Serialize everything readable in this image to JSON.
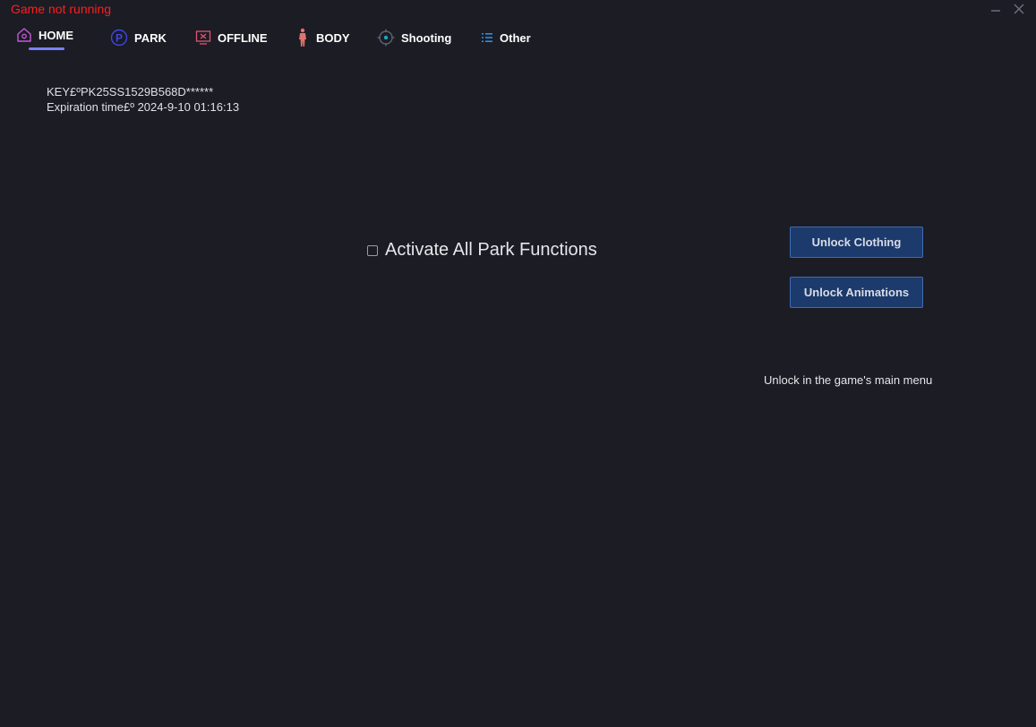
{
  "status": {
    "text": "Game not running",
    "color": "#ff1e1e"
  },
  "window_controls": {
    "minimize_icon": "minimize-icon",
    "close_icon": "close-icon"
  },
  "nav": {
    "active": "HOME",
    "accent": "#7b80ff",
    "tabs": [
      {
        "label": "HOME",
        "icon": "home-icon"
      },
      {
        "label": "PARK",
        "icon": "park-icon"
      },
      {
        "label": "OFFLINE",
        "icon": "offline-icon"
      },
      {
        "label": "BODY",
        "icon": "body-icon"
      },
      {
        "label": "Shooting",
        "icon": "crosshair-icon"
      },
      {
        "label": "Other",
        "icon": "list-icon"
      }
    ]
  },
  "key_info": {
    "key_line": "KEY£ºPK25SS1529B568D******",
    "expiration_line": "Expiration time£º 2024-9-10  01:16:13"
  },
  "park": {
    "label": "Activate All Park Functions",
    "checked": false
  },
  "buttons": {
    "unlock_clothing": "Unlock Clothing",
    "unlock_animations": "Unlock Animations"
  },
  "hint": "Unlock in the game's main menu",
  "colors": {
    "background": "#1b1c24",
    "button_fill": "#1c3a6b",
    "button_border": "#3e6cb4"
  }
}
